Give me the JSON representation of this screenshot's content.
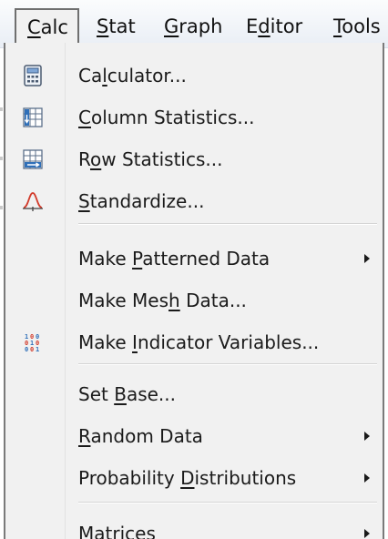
{
  "menubar": {
    "items": [
      {
        "label": "Calc",
        "access_key": "C"
      },
      {
        "label": "Stat",
        "access_key": "S"
      },
      {
        "label": "Graph",
        "access_key": "G"
      },
      {
        "label": "Editor",
        "access_key": "d"
      },
      {
        "label": "Tools",
        "access_key": "T"
      }
    ],
    "active": "Calc"
  },
  "calc_menu": {
    "items": [
      {
        "before": "Ca",
        "key": "l",
        "after": "culator...",
        "icon": "calculator-icon",
        "submenu": false
      },
      {
        "before": "",
        "key": "C",
        "after": "olumn Statistics...",
        "icon": "column-statistics-icon",
        "submenu": false
      },
      {
        "before": "R",
        "key": "o",
        "after": "w Statistics...",
        "icon": "row-statistics-icon",
        "submenu": false
      },
      {
        "before": "",
        "key": "S",
        "after": "tandardize...",
        "icon": "standardize-icon",
        "submenu": false
      },
      {
        "before": "Make ",
        "key": "P",
        "after": "atterned Data",
        "icon": "",
        "submenu": true
      },
      {
        "before": "Make Mes",
        "key": "h",
        "after": " Data...",
        "icon": "",
        "submenu": false
      },
      {
        "before": "Make ",
        "key": "I",
        "after": "ndicator Variables...",
        "icon": "indicator-variables-icon",
        "submenu": false
      },
      {
        "before": "Set ",
        "key": "B",
        "after": "ase...",
        "icon": "",
        "submenu": false
      },
      {
        "before": "",
        "key": "R",
        "after": "andom Data",
        "icon": "",
        "submenu": true
      },
      {
        "before": "Probability ",
        "key": "D",
        "after": "istributions",
        "icon": "",
        "submenu": true
      },
      {
        "before": "",
        "key": "M",
        "after": "atrices",
        "icon": "",
        "submenu": true
      }
    ]
  },
  "colors": {
    "menu_background": "#f1f1f1",
    "menubar_gradient_top": "#fbfcfd",
    "menubar_gradient_bottom": "#e9eef5",
    "border": "#7a7a7a",
    "icon_blue": "#2f6fb8",
    "icon_red": "#d23b2b"
  }
}
